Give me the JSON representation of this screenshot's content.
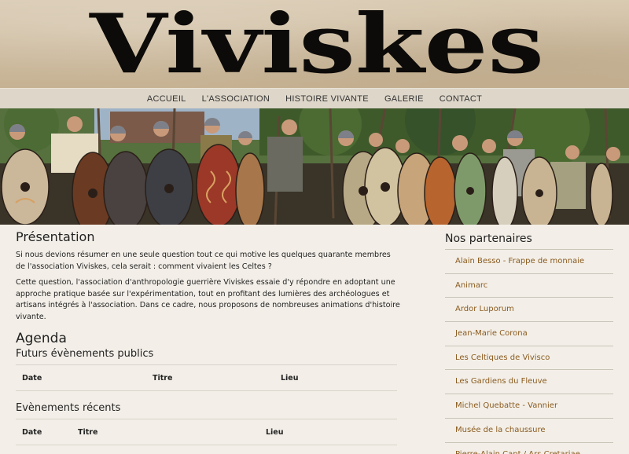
{
  "site": {
    "logo_text": "Viviskes"
  },
  "nav": {
    "items": [
      "ACCUEIL",
      "L'ASSOCIATION",
      "HISTOIRE VIVANTE",
      "GALERIE",
      "CONTACT"
    ]
  },
  "main": {
    "presentation_title": "Présentation",
    "paragraph_1": "Si nous devions résumer en une seule question tout ce qui motive les quelques quarante membres de l'association Viviskes, cela serait : comment vivaient les Celtes ?",
    "paragraph_2": "Cette question, l'association d'anthropologie guerrière Viviskes essaie d'y répondre en adoptant une approche pratique basée sur l'expérimentation, tout en profitant des lumières des archéologues et artisans intégrés à l'association. Dans ce cadre, nous proposons de nombreuses animations d'histoire vivante.",
    "agenda_title": "Agenda",
    "future_events": {
      "title": "Futurs évènements publics",
      "columns": [
        "Date",
        "Titre",
        "Lieu"
      ]
    },
    "recent_events": {
      "title": "Evènements récents",
      "columns": [
        "Date",
        "Titre",
        "Lieu"
      ]
    }
  },
  "sidebar": {
    "title": "Nos partenaires",
    "partners": [
      "Alain Besso - Frappe de monnaie",
      "Animarc",
      "Ardor Luporum",
      "Jean-Marie Corona",
      "Les Celtiques de Vivisco",
      "Les Gardiens du Fleuve",
      "Michel Quebatte - Vannier",
      "Musée de la chaussure",
      "Pierre-Alain Capt / Ars Cretariae"
    ]
  },
  "colors": {
    "accent_link": "#8a5a1e",
    "header_bg": "#cdbb9f",
    "nav_bg": "#ddd6c9",
    "page_bg": "#f3efe8"
  }
}
